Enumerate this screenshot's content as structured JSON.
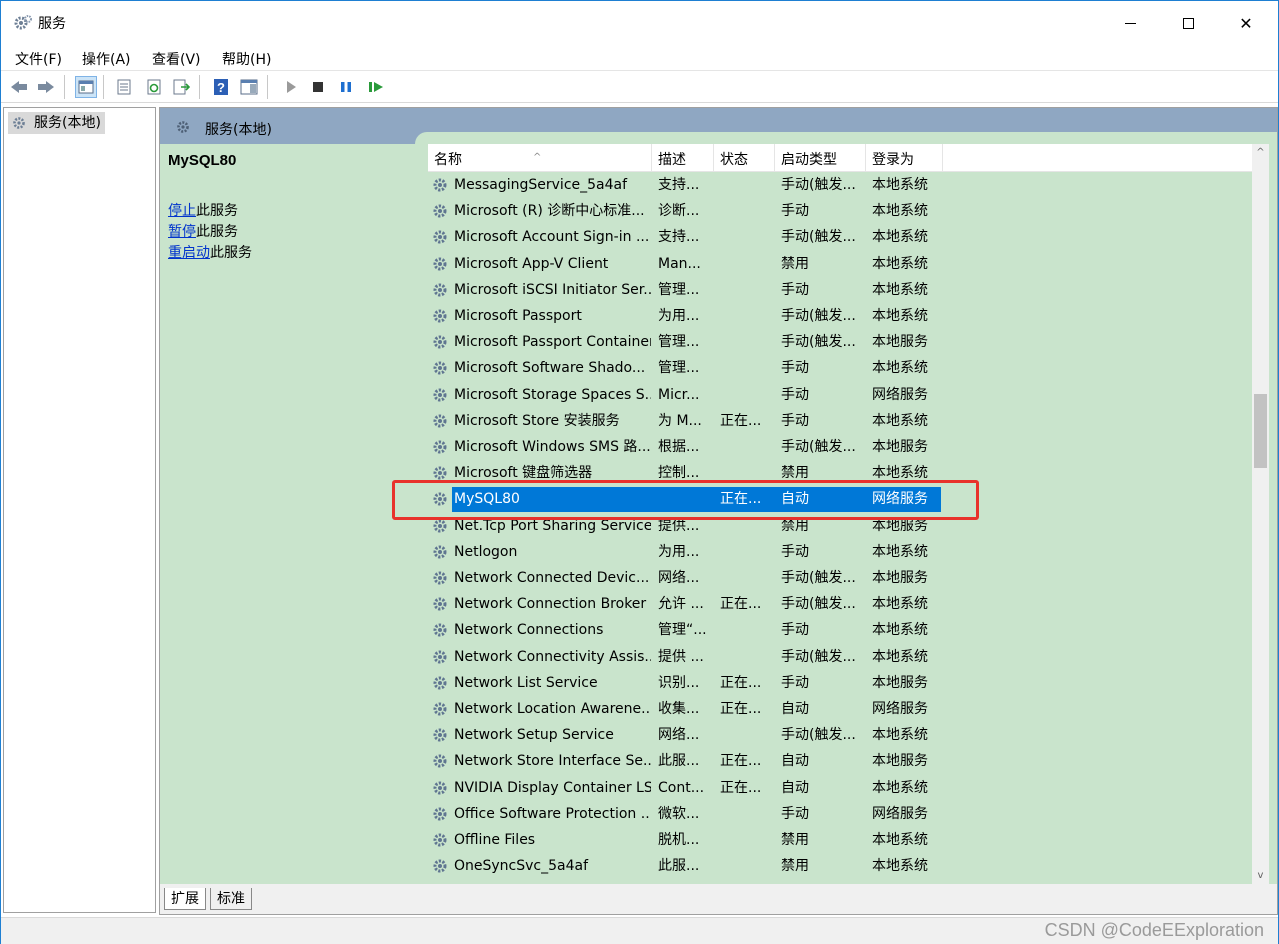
{
  "window": {
    "title": "服务"
  },
  "menu": [
    "文件(F)",
    "操作(A)",
    "查看(V)",
    "帮助(H)"
  ],
  "tree": {
    "root_label": "服务(本地)"
  },
  "right_header": {
    "title": "服务(本地)"
  },
  "description": {
    "service_name": "MySQL80",
    "actions": [
      {
        "link": "停止",
        "suffix": "此服务"
      },
      {
        "link": "暂停",
        "suffix": "此服务"
      },
      {
        "link": "重启动",
        "suffix": "此服务"
      }
    ]
  },
  "columns": [
    "名称",
    "描述",
    "状态",
    "启动类型",
    "登录为"
  ],
  "rows": [
    {
      "name": "MessagingService_5a4af",
      "desc": "支持...",
      "status": "",
      "start": "手动(触发...",
      "logon": "本地系统"
    },
    {
      "name": "Microsoft (R) 诊断中心标准...",
      "desc": "诊断...",
      "status": "",
      "start": "手动",
      "logon": "本地系统"
    },
    {
      "name": "Microsoft Account Sign-in ...",
      "desc": "支持...",
      "status": "",
      "start": "手动(触发...",
      "logon": "本地系统"
    },
    {
      "name": "Microsoft App-V Client",
      "desc": "Man...",
      "status": "",
      "start": "禁用",
      "logon": "本地系统"
    },
    {
      "name": "Microsoft iSCSI Initiator Ser...",
      "desc": "管理...",
      "status": "",
      "start": "手动",
      "logon": "本地系统"
    },
    {
      "name": "Microsoft Passport",
      "desc": "为用...",
      "status": "",
      "start": "手动(触发...",
      "logon": "本地系统"
    },
    {
      "name": "Microsoft Passport Container",
      "desc": "管理...",
      "status": "",
      "start": "手动(触发...",
      "logon": "本地服务"
    },
    {
      "name": "Microsoft Software Shado...",
      "desc": "管理...",
      "status": "",
      "start": "手动",
      "logon": "本地系统"
    },
    {
      "name": "Microsoft Storage Spaces S...",
      "desc": "Micr...",
      "status": "",
      "start": "手动",
      "logon": "网络服务"
    },
    {
      "name": "Microsoft Store 安装服务",
      "desc": "为 M...",
      "status": "正在...",
      "start": "手动",
      "logon": "本地系统"
    },
    {
      "name": "Microsoft Windows SMS 路...",
      "desc": "根据...",
      "status": "",
      "start": "手动(触发...",
      "logon": "本地服务"
    },
    {
      "name": "Microsoft 键盘筛选器",
      "desc": "控制...",
      "status": "",
      "start": "禁用",
      "logon": "本地系统"
    },
    {
      "name": "MySQL80",
      "desc": "",
      "status": "正在...",
      "start": "自动",
      "logon": "网络服务",
      "selected": true
    },
    {
      "name": "Net.Tcp Port Sharing Service",
      "desc": "提供...",
      "status": "",
      "start": "禁用",
      "logon": "本地服务"
    },
    {
      "name": "Netlogon",
      "desc": "为用...",
      "status": "",
      "start": "手动",
      "logon": "本地系统"
    },
    {
      "name": "Network Connected Devic...",
      "desc": "网络...",
      "status": "",
      "start": "手动(触发...",
      "logon": "本地服务"
    },
    {
      "name": "Network Connection Broker",
      "desc": "允许 ...",
      "status": "正在...",
      "start": "手动(触发...",
      "logon": "本地系统"
    },
    {
      "name": "Network Connections",
      "desc": "管理“...",
      "status": "",
      "start": "手动",
      "logon": "本地系统"
    },
    {
      "name": "Network Connectivity Assis...",
      "desc": "提供 ...",
      "status": "",
      "start": "手动(触发...",
      "logon": "本地系统"
    },
    {
      "name": "Network List Service",
      "desc": "识别...",
      "status": "正在...",
      "start": "手动",
      "logon": "本地服务"
    },
    {
      "name": "Network Location Awarene...",
      "desc": "收集...",
      "status": "正在...",
      "start": "自动",
      "logon": "网络服务"
    },
    {
      "name": "Network Setup Service",
      "desc": "网络...",
      "status": "",
      "start": "手动(触发...",
      "logon": "本地系统"
    },
    {
      "name": "Network Store Interface Se...",
      "desc": "此服...",
      "status": "正在...",
      "start": "自动",
      "logon": "本地服务"
    },
    {
      "name": "NVIDIA Display Container LS",
      "desc": "Cont...",
      "status": "正在...",
      "start": "自动",
      "logon": "本地系统"
    },
    {
      "name": "Office Software Protection ...",
      "desc": "微软...",
      "status": "",
      "start": "手动",
      "logon": "网络服务"
    },
    {
      "name": "Offline Files",
      "desc": "脱机...",
      "status": "",
      "start": "禁用",
      "logon": "本地系统"
    },
    {
      "name": "OneSyncSvc_5a4af",
      "desc": "此服...",
      "status": "",
      "start": "禁用",
      "logon": "本地系统"
    }
  ],
  "tabs": [
    "扩展",
    "标准"
  ],
  "watermark": "CSDN @CodeEExploration",
  "colors": {
    "selection": "#0078d7",
    "pane_bg": "#c9e4cc",
    "header_bg": "#8fa7c2",
    "highlight": "#e8322b"
  }
}
